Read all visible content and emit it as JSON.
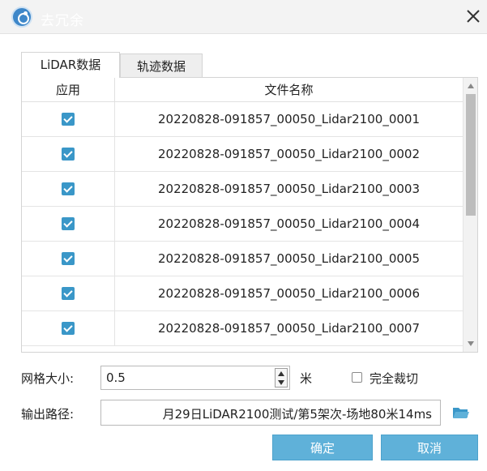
{
  "window": {
    "title": "去冗余",
    "icon": "app-logo-icon",
    "title_bg_color": "#f3f3f3"
  },
  "tabs": [
    {
      "label": "LiDAR数据",
      "active": true
    },
    {
      "label": "轨迹数据",
      "active": false
    }
  ],
  "table": {
    "columns": [
      "应用",
      "文件名称"
    ],
    "rows": [
      {
        "checked": true,
        "name": "20220828-091857_00050_Lidar2100_0001"
      },
      {
        "checked": true,
        "name": "20220828-091857_00050_Lidar2100_0002"
      },
      {
        "checked": true,
        "name": "20220828-091857_00050_Lidar2100_0003"
      },
      {
        "checked": true,
        "name": "20220828-091857_00050_Lidar2100_0004"
      },
      {
        "checked": true,
        "name": "20220828-091857_00050_Lidar2100_0005"
      },
      {
        "checked": true,
        "name": "20220828-091857_00050_Lidar2100_0006"
      },
      {
        "checked": true,
        "name": "20220828-091857_00050_Lidar2100_0007"
      }
    ],
    "checkbox_color": "#3a97c8"
  },
  "grid_size": {
    "label": "网格大小:",
    "value": "0.5",
    "unit": "米"
  },
  "full_crop": {
    "label": "完全裁切",
    "checked": false
  },
  "output_path": {
    "label": "输出路径:",
    "value": "月29日LiDAR2100测试/第5架次-场地80米14ms"
  },
  "buttons": {
    "ok_label": "确定",
    "cancel_label": "取消",
    "color": "#5fb1d9"
  }
}
